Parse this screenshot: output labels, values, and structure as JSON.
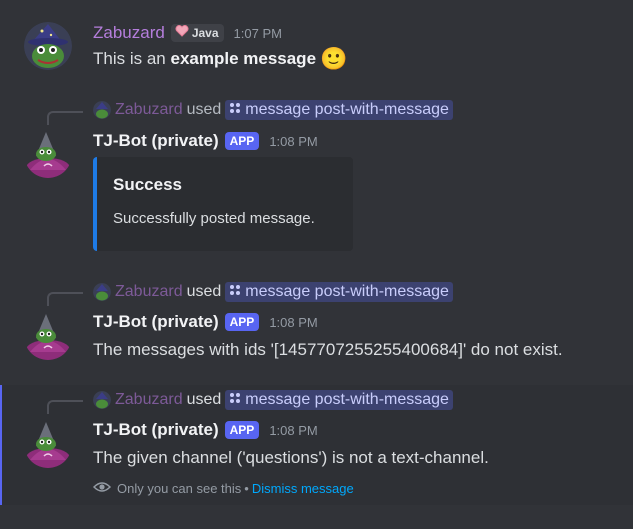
{
  "message1": {
    "username": "Zabuzard",
    "badge": "Java",
    "timestamp": "1:07 PM",
    "text_plain": "This is an ",
    "text_bold": "example message",
    "emoji": "🙂"
  },
  "reply": {
    "user": "Zabuzard",
    "used": "used",
    "command": "message post-with-message"
  },
  "bot": {
    "name": "TJ-Bot (private)",
    "badge": "APP"
  },
  "message2": {
    "timestamp": "1:08 PM",
    "embed_title": "Success",
    "embed_description": "Successfully posted message.",
    "embed_color": "#1e7be6"
  },
  "message3": {
    "timestamp": "1:08 PM",
    "text": "The messages with ids '[1457707255255400684]' do not exist."
  },
  "message4": {
    "timestamp": "1:08 PM",
    "text": "The given channel ('questions') is not a text-channel.",
    "ephemeral_note": "Only you can see this",
    "separator": "•",
    "dismiss": "Dismiss message"
  },
  "icons": {
    "command_icon": "slash-command-icon",
    "eye_icon": "eye-icon",
    "badge_icon": "heart-badge-icon"
  },
  "colors": {
    "background": "#313338",
    "highlight": "#2e3035",
    "accent": "#5865f2",
    "username": "#b57edc"
  }
}
